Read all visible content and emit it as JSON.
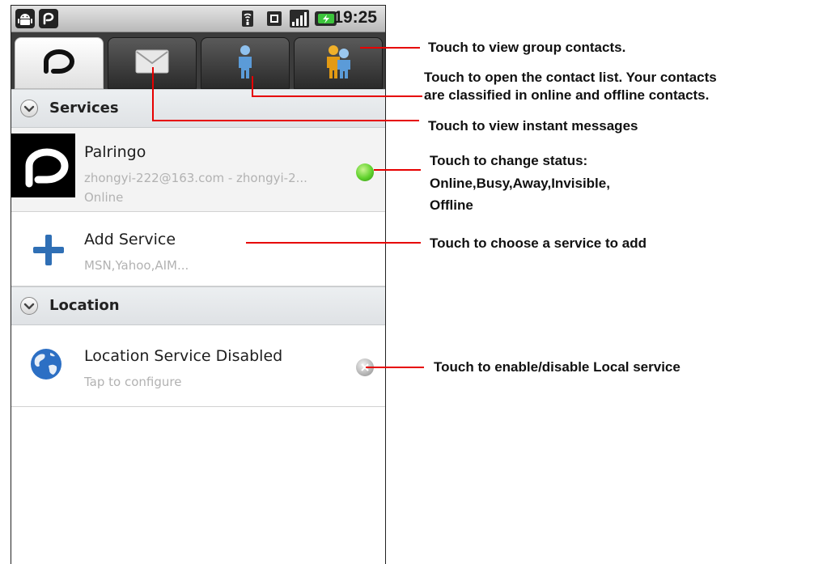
{
  "status_bar": {
    "time": "19:25"
  },
  "tabs": [
    {
      "name": "palringo-tab",
      "icon": "palringo-logo-icon",
      "active": true
    },
    {
      "name": "messages-tab",
      "icon": "envelope-icon",
      "active": false
    },
    {
      "name": "contacts-tab",
      "icon": "person-icon",
      "active": false
    },
    {
      "name": "group-contacts-tab",
      "icon": "group-icon",
      "active": false
    }
  ],
  "services_section": {
    "title": "Services",
    "palringo": {
      "title": "Palringo",
      "account": "zhongyi-222@163.com - zhongyi-2...",
      "status": "Online",
      "status_color": "#5fd12c"
    },
    "add_service": {
      "title": "Add Service",
      "subtitle": "MSN,Yahoo,AIM..."
    }
  },
  "location_section": {
    "title": "Location",
    "item": {
      "title": "Location Service Disabled",
      "subtitle": "Tap to configure"
    }
  },
  "annotations": {
    "group_contacts": "Touch to view group contacts.",
    "contact_list_line1": "Touch to open the contact list. Your contacts",
    "contact_list_line2": "are classified in online and offline contacts.",
    "instant_messages": "Touch to view instant messages",
    "change_status_line1": "Touch to change status:",
    "change_status_line2": "Online,Busy,Away,Invisible,",
    "change_status_line3": "Offline",
    "add_service": "Touch to choose a service to add",
    "local_service": "Touch to enable/disable Local service"
  },
  "colors": {
    "callout": "#e60000",
    "accent_blue": "#2f6fb5"
  }
}
